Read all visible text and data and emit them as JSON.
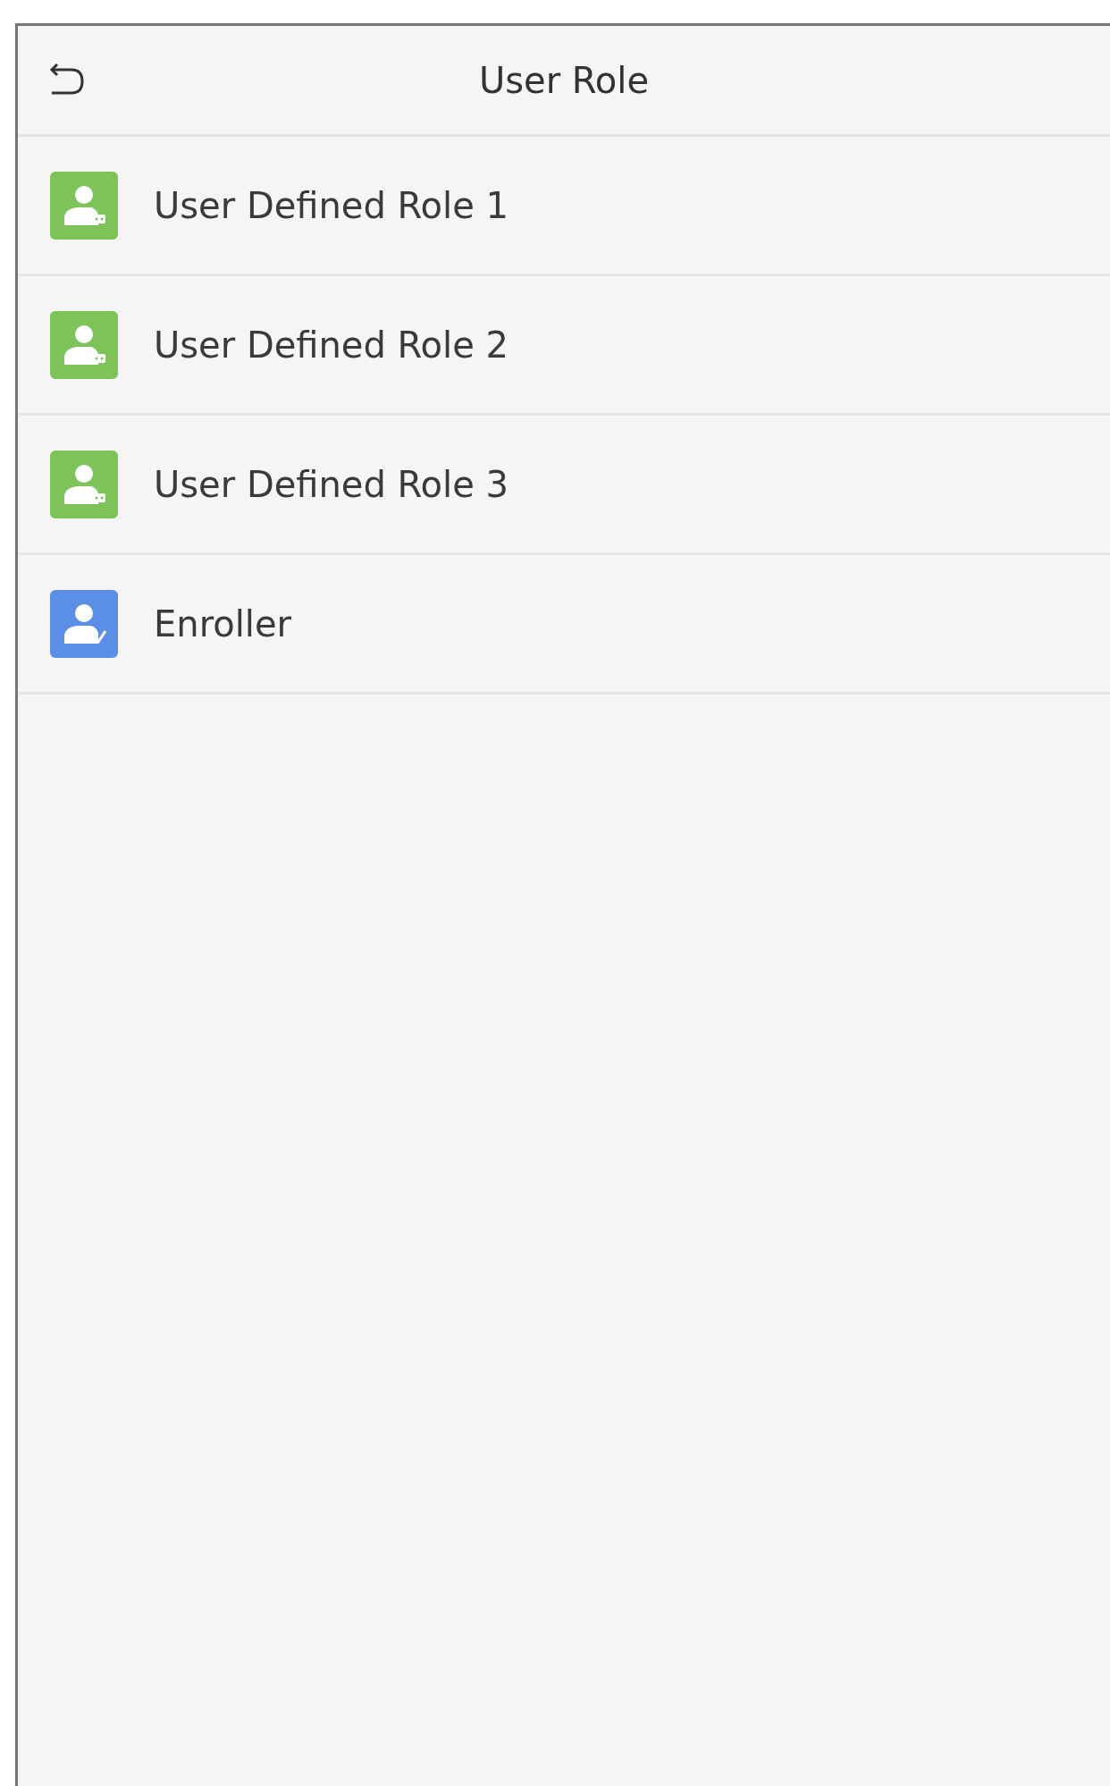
{
  "header": {
    "title": "User Role"
  },
  "roles": [
    {
      "label": "User Defined Role 1",
      "kind": "custom",
      "color": "#7ec35a"
    },
    {
      "label": "User Defined Role 2",
      "kind": "custom",
      "color": "#7ec35a"
    },
    {
      "label": "User Defined Role 3",
      "kind": "custom",
      "color": "#7ec35a"
    },
    {
      "label": "Enroller",
      "kind": "enroller",
      "color": "#5b8fe6"
    }
  ]
}
